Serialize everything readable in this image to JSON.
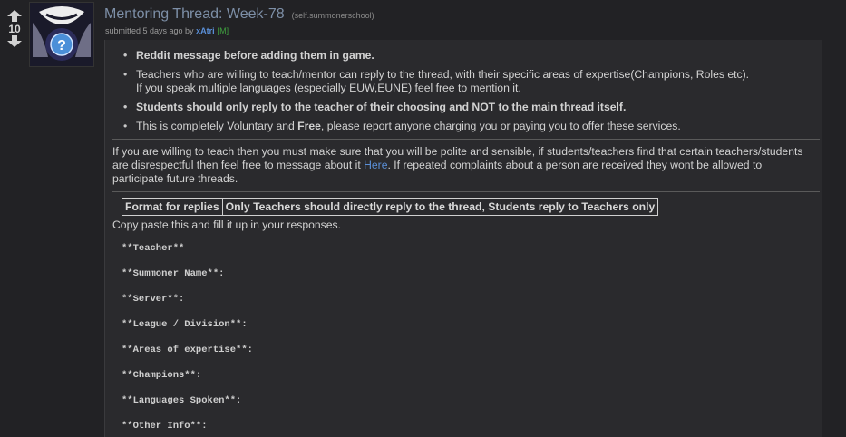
{
  "vote": {
    "score": "10"
  },
  "post": {
    "title": "Mentoring Thread: Week-78",
    "domain": "(self.summonerschool)",
    "submitted_prefix": "submitted 5 days ago by",
    "author": "xAtri",
    "mod_tag": "[M]"
  },
  "body": {
    "rules": [
      "Reddit message before adding them in game.",
      "Teachers who are willing to teach/mentor can reply to the thread, with their specific areas of expertise(Champions, Roles etc).",
      "If you speak multiple languages (especially EUW,EUNE) feel free to mention it.",
      "Students should only reply to the teacher of their choosing and NOT to the main thread itself.",
      "This is completely Voluntary and ",
      "Free",
      ", please report anyone charging you or paying you to offer these services."
    ],
    "para1_a": "If you are willing to teach then you must make sure that you will be polite and sensible, if students/teachers find that certain teachers/students are disrespectful then feel free to message about it ",
    "para1_link": "Here",
    "para1_b": ". If repeated complaints about a person are received they wont be allowed to participate future threads.",
    "table_headers": [
      "Format for replies",
      "Only Teachers should directly reply to the thread, Students reply to Teachers only"
    ],
    "copy_paste": "Copy paste this and fill it up in your responses.",
    "template_fields": [
      "**Teacher**",
      "**Summoner Name**:",
      "**Server**:",
      "**League / Division**:",
      "**Areas of expertise**:",
      "**Champions**:",
      "**Languages Spoken**:",
      "**Other Info**:"
    ]
  }
}
